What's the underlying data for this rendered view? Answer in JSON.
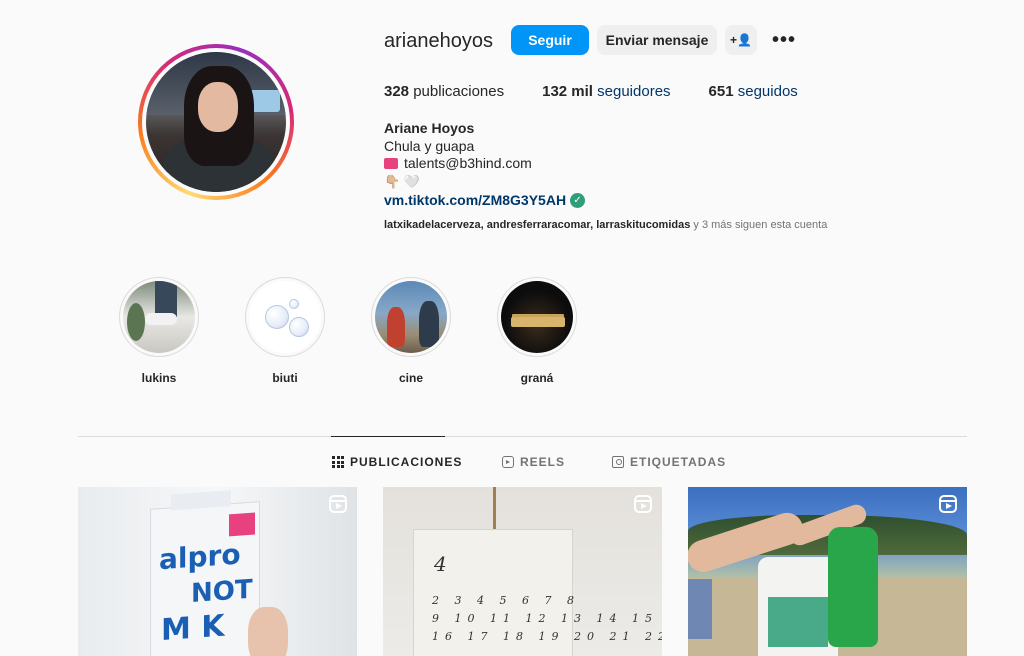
{
  "profile": {
    "username": "arianehoyos",
    "follow_label": "Seguir",
    "message_label": "Enviar mensaje",
    "add_user_icon": "+person-icon",
    "more_label": "•••",
    "stats": {
      "posts_count": "328",
      "posts_label": "publicaciones",
      "followers_count": "132 mil",
      "followers_label": "seguidores",
      "following_count": "651",
      "following_label": "seguidos"
    },
    "bio": {
      "full_name": "Ariane Hoyos",
      "line1": "Chula y guapa",
      "email": "talents@b3hind.com",
      "emoji_line": "👇🏼 🤍",
      "link": "vm.tiktok.com/ZM8G3Y5AH",
      "verified_mark": "✓"
    },
    "followed_by": {
      "names": "latxikadelacerveza, andresferraracomar, larraskitucomidas",
      "suffix": " y 3 más siguen esta cuenta"
    }
  },
  "highlights": [
    {
      "label": "lukins"
    },
    {
      "label": "biuti"
    },
    {
      "label": "cine"
    },
    {
      "label": "graná"
    }
  ],
  "tabs": [
    {
      "label": "PUBLICACIONES",
      "icon": "grid-icon",
      "active": true
    },
    {
      "label": "REELS",
      "icon": "reels-icon",
      "active": false
    },
    {
      "label": "ETIQUETADAS",
      "icon": "tag-icon",
      "active": false
    }
  ],
  "posts": [
    {
      "type": "reel",
      "product_text_1": "alpro",
      "product_text_2": "NOT",
      "product_text_3": "M K"
    },
    {
      "type": "reel",
      "calendar_month": "4",
      "calendar_rows": "2 3 4 5 6 7 8\n9 10 11 12 13 14 15\n16 17 18 19 20 21 22"
    },
    {
      "type": "reel"
    }
  ],
  "colors": {
    "accent": "#0095f6",
    "link": "#00376b",
    "verified": "#2f9e7a"
  }
}
